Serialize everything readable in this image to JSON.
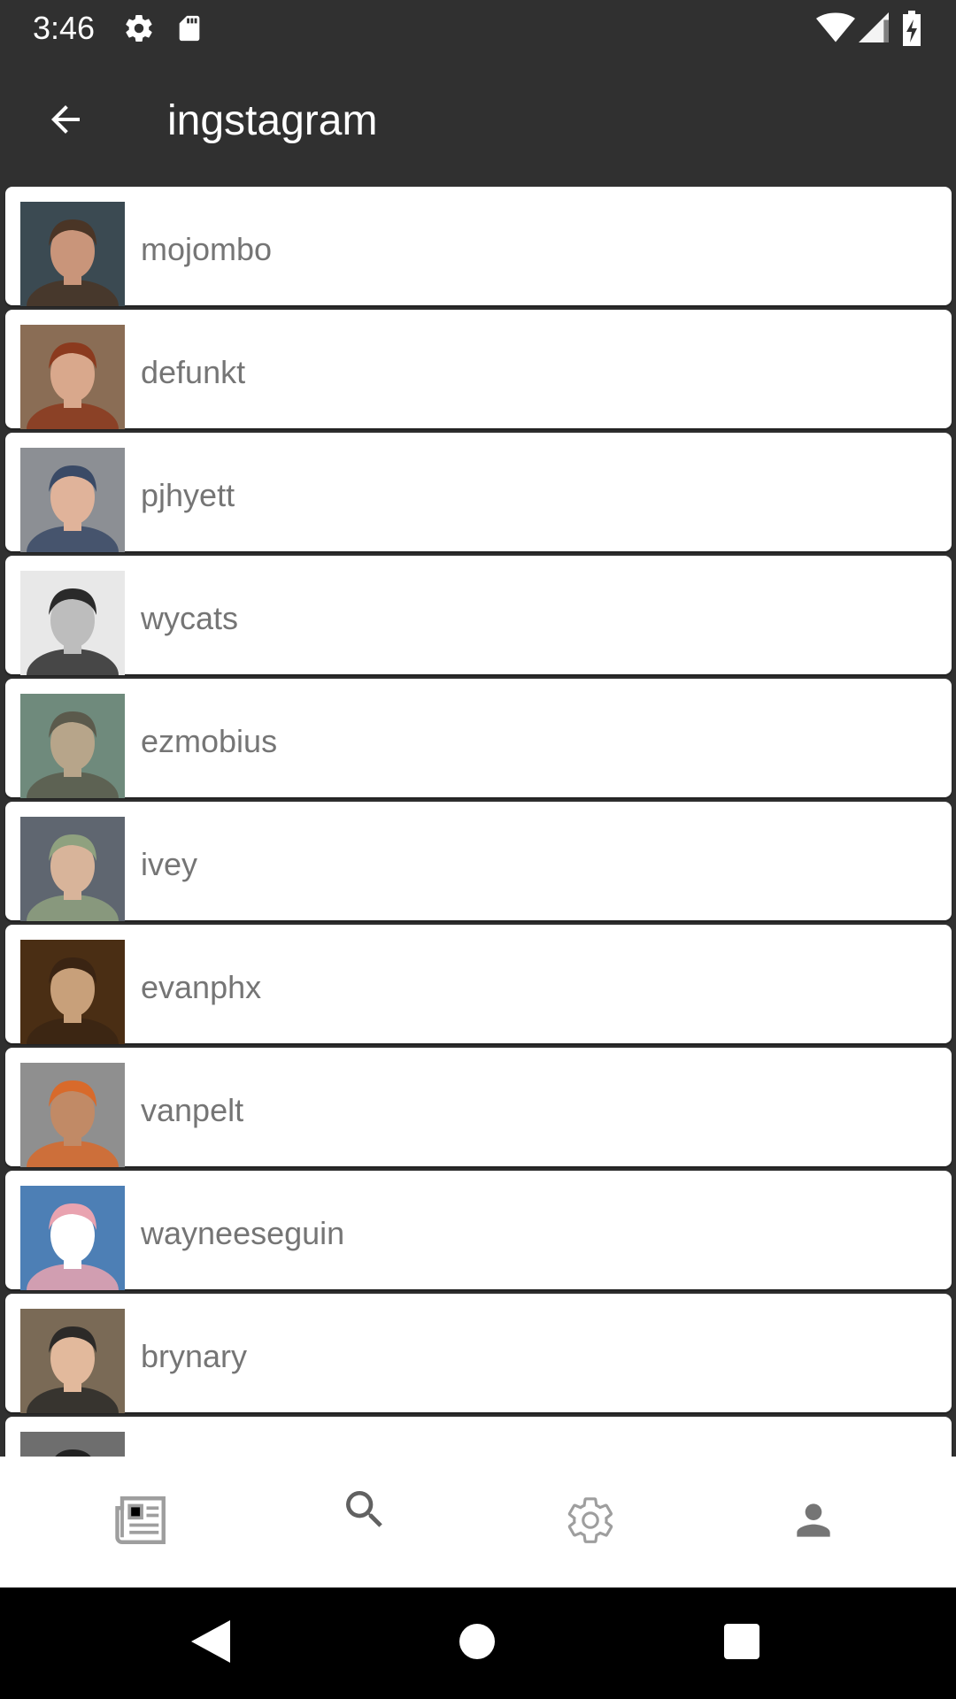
{
  "status_bar": {
    "time": "3:46",
    "icons": [
      "gear-icon",
      "sd-card-icon",
      "wifi-icon",
      "signal-icon",
      "battery-charging-icon"
    ]
  },
  "app_bar": {
    "title": "ingstagram",
    "back_icon": "arrow-back-icon"
  },
  "users": [
    {
      "login": "mojombo",
      "avatar": {
        "bg": "#3b4a52",
        "skin": "#c9957a",
        "hair": "#4a3526"
      }
    },
    {
      "login": "defunkt",
      "avatar": {
        "bg": "#8a6d55",
        "skin": "#d9a88c",
        "hair": "#8b3a1e"
      }
    },
    {
      "login": "pjhyett",
      "avatar": {
        "bg": "#8c8f94",
        "skin": "#e0b39a",
        "hair": "#3a4a66"
      }
    },
    {
      "login": "wycats",
      "avatar": {
        "bg": "#e8e8e8",
        "skin": "#bdbdbd",
        "hair": "#2a2a2a"
      }
    },
    {
      "login": "ezmobius",
      "avatar": {
        "bg": "#6f8a7c",
        "skin": "#b7a58a",
        "hair": "#5b5a4c"
      }
    },
    {
      "login": "ivey",
      "avatar": {
        "bg": "#5f6670",
        "skin": "#d8b49a",
        "hair": "#8fa17f"
      }
    },
    {
      "login": "evanphx",
      "avatar": {
        "bg": "#4a2e14",
        "skin": "#c8a07a",
        "hair": "#3a2413"
      }
    },
    {
      "login": "vanpelt",
      "avatar": {
        "bg": "#8f8f8f",
        "skin": "#c18a66",
        "hair": "#d86a2b"
      }
    },
    {
      "login": "wayneeseguin",
      "avatar": {
        "bg": "#4d7fb5",
        "skin": "#ffffff",
        "hair": "#e9a3b0"
      }
    },
    {
      "login": "brynary",
      "avatar": {
        "bg": "#7a6a56",
        "skin": "#e2b99c",
        "hair": "#2c2a28"
      }
    },
    {
      "login": "",
      "avatar": {
        "bg": "#6e6e6e",
        "skin": "#c7a08a",
        "hair": "#222222"
      }
    }
  ],
  "bottom_nav": {
    "items": [
      {
        "icon": "newspaper-icon",
        "color": "#9e9e9e"
      },
      {
        "icon": "search-icon",
        "color": "#616161"
      },
      {
        "icon": "settings-gear-icon",
        "color": "#9e9e9e"
      },
      {
        "icon": "person-icon",
        "color": "#757575"
      }
    ]
  },
  "system_nav": {
    "icons": [
      "back-triangle-icon",
      "home-circle-icon",
      "recents-square-icon"
    ]
  }
}
